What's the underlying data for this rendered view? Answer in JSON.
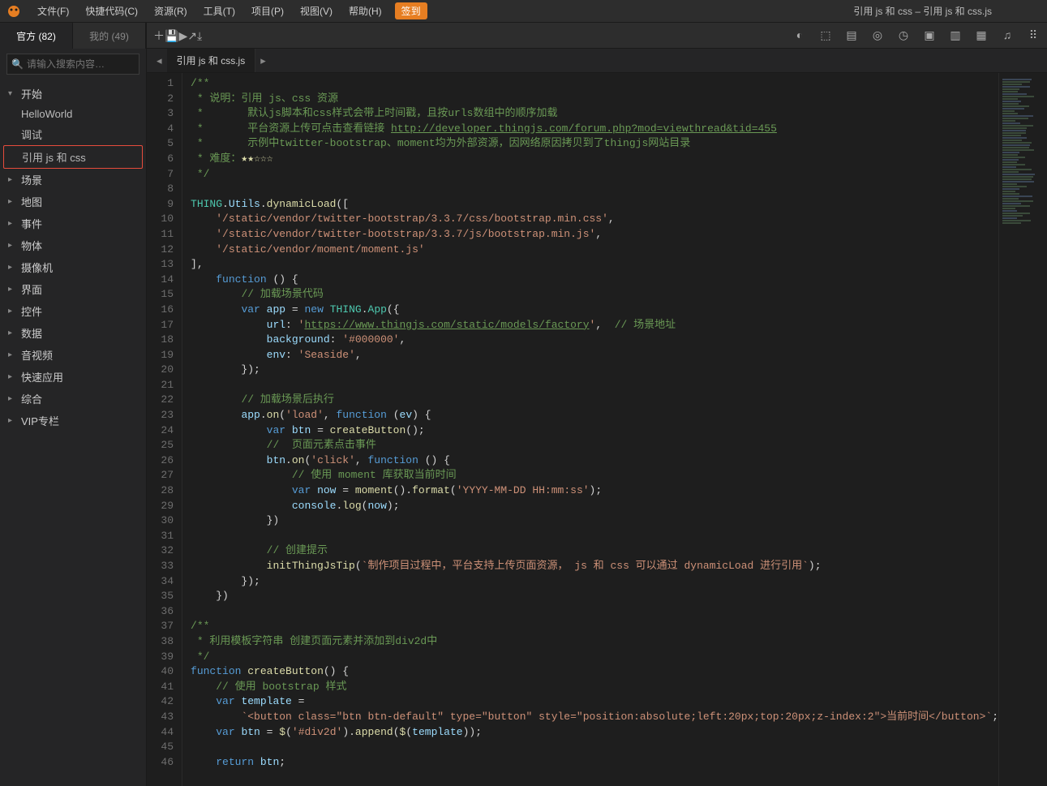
{
  "window_title": "引用 js 和 css – 引用 js 和 css.js",
  "menubar": {
    "items": [
      "文件(F)",
      "快捷代码(C)",
      "资源(R)",
      "工具(T)",
      "项目(P)",
      "视图(V)",
      "帮助(H)"
    ],
    "sign": "签到"
  },
  "sidebar": {
    "tabs": [
      {
        "label": "官方 (82)",
        "active": true
      },
      {
        "label": "我的 (49)",
        "active": false
      }
    ],
    "search_placeholder": "请输入搜索内容…",
    "tree": [
      {
        "label": "开始",
        "expanded": true,
        "children": [
          {
            "label": "HelloWorld"
          },
          {
            "label": "调试"
          },
          {
            "label": "引用 js 和 css",
            "selected": true
          }
        ]
      },
      {
        "label": "场景"
      },
      {
        "label": "地图"
      },
      {
        "label": "事件"
      },
      {
        "label": "物体"
      },
      {
        "label": "摄像机"
      },
      {
        "label": "界面"
      },
      {
        "label": "控件"
      },
      {
        "label": "数据"
      },
      {
        "label": "音视频"
      },
      {
        "label": "快速应用"
      },
      {
        "label": "综合"
      },
      {
        "label": "VIP专栏"
      }
    ]
  },
  "toolbar_left_icons": [
    "plus-icon",
    "save-icon",
    "run-icon",
    "share-icon",
    "download-icon"
  ],
  "toolbar_right_icons": [
    "globe-icon",
    "box-icon",
    "book-icon",
    "browser-icon",
    "clock-icon",
    "window-icon",
    "layers-icon",
    "image-icon",
    "music-icon",
    "grid-icon"
  ],
  "file_tab": "引用 js 和 css.js",
  "code": {
    "lines": [
      [
        {
          "c": "c-comment",
          "t": "/**"
        }
      ],
      [
        {
          "c": "c-comment",
          "t": " * 说明：引用 js、css 资源"
        }
      ],
      [
        {
          "c": "c-comment",
          "t": " *       默认js脚本和css样式会带上时间戳，且按urls数组中的顺序加载"
        }
      ],
      [
        {
          "c": "c-comment",
          "t": " *       平台资源上传可点击查看链接 "
        },
        {
          "c": "c-url",
          "t": "http://developer.thingjs.com/forum.php?mod=viewthread&tid=455"
        }
      ],
      [
        {
          "c": "c-comment",
          "t": " *       示例中twitter-bootstrap、moment均为外部资源，因网络原因拷贝到了thingjs网站目录"
        }
      ],
      [
        {
          "c": "c-comment",
          "t": " * 难度："
        },
        {
          "c": "c-star",
          "t": "★★☆☆☆"
        }
      ],
      [
        {
          "c": "c-comment",
          "t": " */"
        }
      ],
      [
        {
          "t": ""
        }
      ],
      [
        {
          "c": "c-class",
          "t": "THING"
        },
        {
          "t": "."
        },
        {
          "c": "c-prop",
          "t": "Utils"
        },
        {
          "t": "."
        },
        {
          "c": "c-func",
          "t": "dynamicLoad"
        },
        {
          "t": "(["
        }
      ],
      [
        {
          "t": "    "
        },
        {
          "c": "c-string",
          "t": "'/static/vendor/twitter-bootstrap/3.3.7/css/bootstrap.min.css'"
        },
        {
          "t": ","
        }
      ],
      [
        {
          "t": "    "
        },
        {
          "c": "c-string",
          "t": "'/static/vendor/twitter-bootstrap/3.3.7/js/bootstrap.min.js'"
        },
        {
          "t": ","
        }
      ],
      [
        {
          "t": "    "
        },
        {
          "c": "c-string",
          "t": "'/static/vendor/moment/moment.js'"
        }
      ],
      [
        {
          "t": "],"
        }
      ],
      [
        {
          "t": "    "
        },
        {
          "c": "c-keyword",
          "t": "function"
        },
        {
          "t": " () {"
        }
      ],
      [
        {
          "t": "        "
        },
        {
          "c": "c-comment",
          "t": "// 加载场景代码"
        }
      ],
      [
        {
          "t": "        "
        },
        {
          "c": "c-keyword",
          "t": "var"
        },
        {
          "t": " "
        },
        {
          "c": "c-prop",
          "t": "app"
        },
        {
          "t": " = "
        },
        {
          "c": "c-keyword",
          "t": "new"
        },
        {
          "t": " "
        },
        {
          "c": "c-class",
          "t": "THING"
        },
        {
          "t": "."
        },
        {
          "c": "c-class",
          "t": "App"
        },
        {
          "t": "({"
        }
      ],
      [
        {
          "t": "            "
        },
        {
          "c": "c-prop",
          "t": "url"
        },
        {
          "t": ": "
        },
        {
          "c": "c-string",
          "t": "'"
        },
        {
          "c": "c-url c-string",
          "t": "https://www.thingjs.com/static/models/factory"
        },
        {
          "c": "c-string",
          "t": "'"
        },
        {
          "t": ",  "
        },
        {
          "c": "c-comment",
          "t": "// 场景地址"
        }
      ],
      [
        {
          "t": "            "
        },
        {
          "c": "c-prop",
          "t": "background"
        },
        {
          "t": ": "
        },
        {
          "c": "c-string",
          "t": "'#000000'"
        },
        {
          "t": ","
        }
      ],
      [
        {
          "t": "            "
        },
        {
          "c": "c-prop",
          "t": "env"
        },
        {
          "t": ": "
        },
        {
          "c": "c-string",
          "t": "'Seaside'"
        },
        {
          "t": ","
        }
      ],
      [
        {
          "t": "        });"
        }
      ],
      [
        {
          "t": ""
        }
      ],
      [
        {
          "t": "        "
        },
        {
          "c": "c-comment",
          "t": "// 加载场景后执行"
        }
      ],
      [
        {
          "t": "        "
        },
        {
          "c": "c-prop",
          "t": "app"
        },
        {
          "t": "."
        },
        {
          "c": "c-func",
          "t": "on"
        },
        {
          "t": "("
        },
        {
          "c": "c-string",
          "t": "'load'"
        },
        {
          "t": ", "
        },
        {
          "c": "c-keyword",
          "t": "function"
        },
        {
          "t": " ("
        },
        {
          "c": "c-prop",
          "t": "ev"
        },
        {
          "t": ") {"
        }
      ],
      [
        {
          "t": "            "
        },
        {
          "c": "c-keyword",
          "t": "var"
        },
        {
          "t": " "
        },
        {
          "c": "c-prop",
          "t": "btn"
        },
        {
          "t": " = "
        },
        {
          "c": "c-func",
          "t": "createButton"
        },
        {
          "t": "();"
        }
      ],
      [
        {
          "t": "            "
        },
        {
          "c": "c-comment",
          "t": "//  页面元素点击事件"
        }
      ],
      [
        {
          "t": "            "
        },
        {
          "c": "c-prop",
          "t": "btn"
        },
        {
          "t": "."
        },
        {
          "c": "c-func",
          "t": "on"
        },
        {
          "t": "("
        },
        {
          "c": "c-string",
          "t": "'click'"
        },
        {
          "t": ", "
        },
        {
          "c": "c-keyword",
          "t": "function"
        },
        {
          "t": " () {"
        }
      ],
      [
        {
          "t": "                "
        },
        {
          "c": "c-comment",
          "t": "// 使用 moment 库获取当前时间"
        }
      ],
      [
        {
          "t": "                "
        },
        {
          "c": "c-keyword",
          "t": "var"
        },
        {
          "t": " "
        },
        {
          "c": "c-prop",
          "t": "now"
        },
        {
          "t": " = "
        },
        {
          "c": "c-func",
          "t": "moment"
        },
        {
          "t": "()."
        },
        {
          "c": "c-func",
          "t": "format"
        },
        {
          "t": "("
        },
        {
          "c": "c-string",
          "t": "'YYYY-MM-DD HH:mm:ss'"
        },
        {
          "t": ");"
        }
      ],
      [
        {
          "t": "                "
        },
        {
          "c": "c-prop",
          "t": "console"
        },
        {
          "t": "."
        },
        {
          "c": "c-func",
          "t": "log"
        },
        {
          "t": "("
        },
        {
          "c": "c-prop",
          "t": "now"
        },
        {
          "t": ");"
        }
      ],
      [
        {
          "t": "            })"
        }
      ],
      [
        {
          "t": ""
        }
      ],
      [
        {
          "t": "            "
        },
        {
          "c": "c-comment",
          "t": "// 创建提示"
        }
      ],
      [
        {
          "t": "            "
        },
        {
          "c": "c-func",
          "t": "initThingJsTip"
        },
        {
          "t": "("
        },
        {
          "c": "c-string",
          "t": "`制作项目过程中，平台支持上传页面资源， js 和 css 可以通过 dynamicLoad 进行引用`"
        },
        {
          "t": ");"
        }
      ],
      [
        {
          "t": "        });"
        }
      ],
      [
        {
          "t": "    })"
        }
      ],
      [
        {
          "t": ""
        }
      ],
      [
        {
          "c": "c-comment",
          "t": "/**"
        }
      ],
      [
        {
          "c": "c-comment",
          "t": " * 利用模板字符串 创建页面元素并添加到div2d中"
        }
      ],
      [
        {
          "c": "c-comment",
          "t": " */"
        }
      ],
      [
        {
          "c": "c-keyword",
          "t": "function"
        },
        {
          "t": " "
        },
        {
          "c": "c-func",
          "t": "createButton"
        },
        {
          "t": "() {"
        }
      ],
      [
        {
          "t": "    "
        },
        {
          "c": "c-comment",
          "t": "// 使用 bootstrap 样式"
        }
      ],
      [
        {
          "t": "    "
        },
        {
          "c": "c-keyword",
          "t": "var"
        },
        {
          "t": " "
        },
        {
          "c": "c-prop",
          "t": "template"
        },
        {
          "t": " ="
        }
      ],
      [
        {
          "t": "        "
        },
        {
          "c": "c-string",
          "t": "`<button class=\"btn btn-default\" type=\"button\" style=\"position:absolute;left:20px;top:20px;z-index:2\">当前时间</button>`"
        },
        {
          "t": ";"
        }
      ],
      [
        {
          "t": "    "
        },
        {
          "c": "c-keyword",
          "t": "var"
        },
        {
          "t": " "
        },
        {
          "c": "c-prop",
          "t": "btn"
        },
        {
          "t": " = "
        },
        {
          "c": "c-func",
          "t": "$"
        },
        {
          "t": "("
        },
        {
          "c": "c-string",
          "t": "'#div2d'"
        },
        {
          "t": ")."
        },
        {
          "c": "c-func",
          "t": "append"
        },
        {
          "t": "("
        },
        {
          "c": "c-func",
          "t": "$"
        },
        {
          "t": "("
        },
        {
          "c": "c-prop",
          "t": "template"
        },
        {
          "t": "));"
        }
      ],
      [
        {
          "t": ""
        }
      ],
      [
        {
          "t": "    "
        },
        {
          "c": "c-keyword",
          "t": "return"
        },
        {
          "t": " "
        },
        {
          "c": "c-prop",
          "t": "btn"
        },
        {
          "t": ";"
        }
      ]
    ]
  }
}
